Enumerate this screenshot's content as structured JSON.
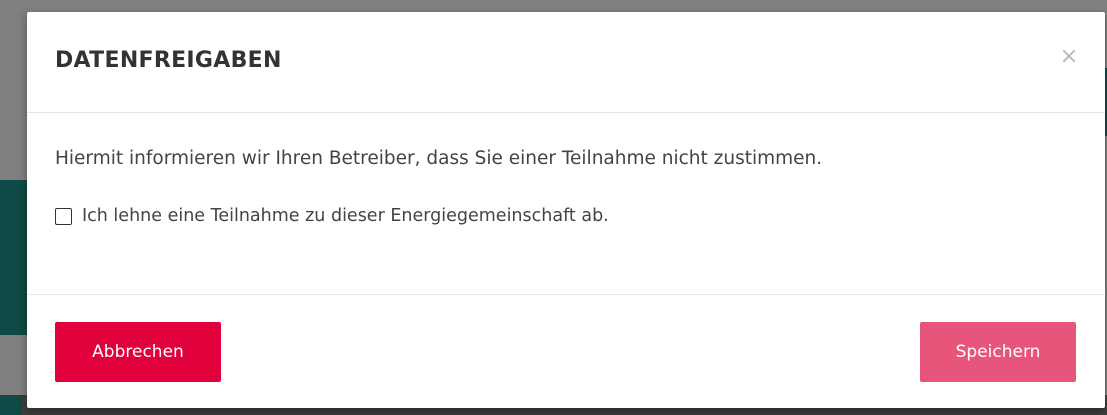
{
  "modal": {
    "title": "DATENFREIGABEN",
    "close_symbol": "×",
    "info_text": "Hiermit informieren wir Ihren Betreiber, dass Sie einer Teilnahme nicht zustimmen.",
    "checkbox": {
      "label": "Ich lehne eine Teilnahme zu dieser Energiegemeinschaft ab.",
      "checked": false
    },
    "buttons": {
      "cancel_label": "Abbrechen",
      "save_label": "Speichern"
    }
  },
  "colors": {
    "cancel_button": "#e0003c",
    "save_button": "#e8557a",
    "backdrop_accent": "#0f4a46"
  },
  "icons": {
    "close": "close-icon",
    "checkbox": "checkbox-unchecked-icon"
  }
}
